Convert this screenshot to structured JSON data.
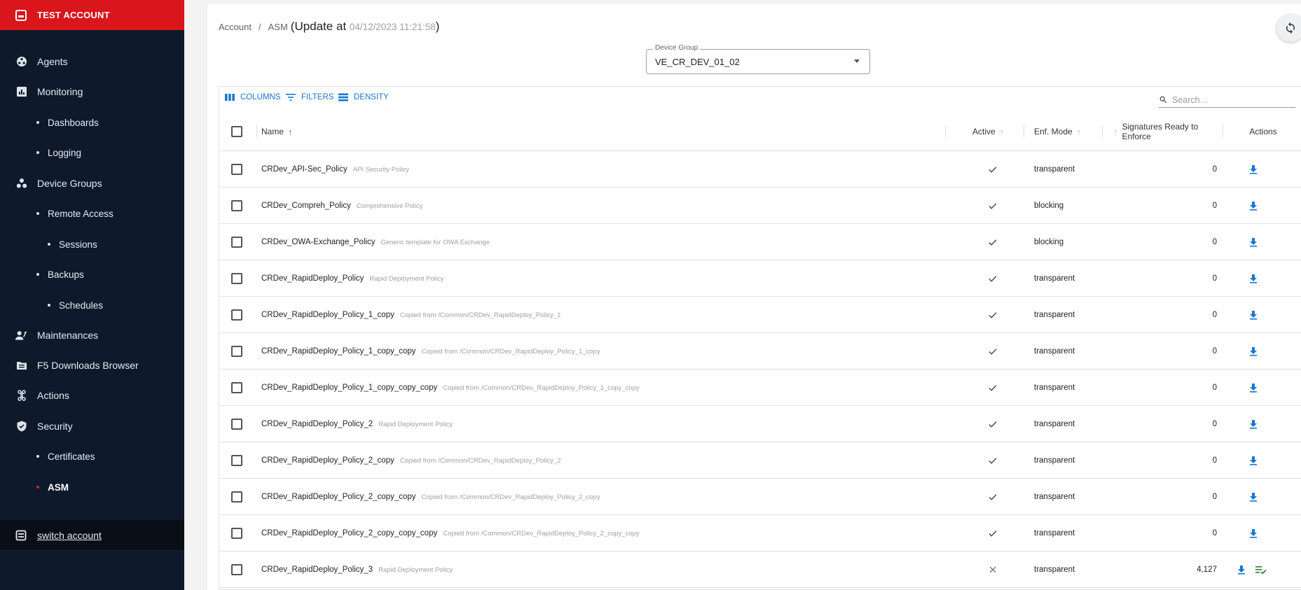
{
  "sidebar": {
    "account_title": "TEST ACCOUNT",
    "items": [
      {
        "label": "Agents",
        "level": "top",
        "icon": "agents-icon"
      },
      {
        "label": "Monitoring",
        "level": "top",
        "icon": "monitoring-icon"
      },
      {
        "label": "Dashboards",
        "level": "sub"
      },
      {
        "label": "Logging",
        "level": "sub"
      },
      {
        "label": "Device Groups",
        "level": "top",
        "icon": "device-groups-icon"
      },
      {
        "label": "Remote Access",
        "level": "sub"
      },
      {
        "label": "Sessions",
        "level": "sub2"
      },
      {
        "label": "Backups",
        "level": "sub"
      },
      {
        "label": "Schedules",
        "level": "sub2"
      },
      {
        "label": "Maintenances",
        "level": "top",
        "icon": "maintenances-icon"
      },
      {
        "label": "F5 Downloads Browser",
        "level": "top",
        "icon": "downloads-browser-icon"
      },
      {
        "label": "Actions",
        "level": "top",
        "icon": "actions-icon"
      },
      {
        "label": "Security",
        "level": "top",
        "icon": "shield-icon"
      },
      {
        "label": "Certificates",
        "level": "sub"
      },
      {
        "label": "ASM",
        "level": "sub",
        "active": true
      }
    ],
    "switch_account_label": "switch account"
  },
  "breadcrumb": {
    "account": "Account",
    "separator": "/",
    "asm": "ASM",
    "update_prefix": "(Update at ",
    "timestamp": "04/12/2023 11:21:58",
    "update_suffix": ")"
  },
  "device_group": {
    "label": "Device Group",
    "value": "VE_CR_DEV_01_02"
  },
  "toolbar": {
    "columns_label": "COLUMNS",
    "filters_label": "FILTERS",
    "density_label": "DENSITY",
    "search_placeholder": "Search…"
  },
  "table": {
    "headers": {
      "name": "Name",
      "active": "Active",
      "enf_mode": "Enf. Mode",
      "signatures": "Signatures Ready to Enforce",
      "actions": "Actions"
    },
    "rows": [
      {
        "name": "CRDev_API-Sec_Policy",
        "desc": "API Security Policy",
        "active": true,
        "mode": "transparent",
        "signatures": "0",
        "extra_action": false
      },
      {
        "name": "CRDev_Compreh_Policy",
        "desc": "Comprehensive Policy",
        "active": true,
        "mode": "blocking",
        "signatures": "0",
        "extra_action": false
      },
      {
        "name": "CRDev_OWA-Exchange_Policy",
        "desc": "Generic template for OWA Exchange",
        "active": true,
        "mode": "blocking",
        "signatures": "0",
        "extra_action": false
      },
      {
        "name": "CRDev_RapidDeploy_Policy",
        "desc": "Rapid Deployment Policy",
        "active": true,
        "mode": "transparent",
        "signatures": "0",
        "extra_action": false
      },
      {
        "name": "CRDev_RapidDeploy_Policy_1_copy",
        "desc": "Copied from /Common/CRDev_RapidDeploy_Policy_1",
        "active": true,
        "mode": "transparent",
        "signatures": "0",
        "extra_action": false
      },
      {
        "name": "CRDev_RapidDeploy_Policy_1_copy_copy",
        "desc": "Copied from /Common/CRDev_RapidDeploy_Policy_1_copy",
        "active": true,
        "mode": "transparent",
        "signatures": "0",
        "extra_action": false
      },
      {
        "name": "CRDev_RapidDeploy_Policy_1_copy_copy_copy",
        "desc": "Copied from /Common/CRDev_RapidDeploy_Policy_1_copy_copy",
        "active": true,
        "mode": "transparent",
        "signatures": "0",
        "extra_action": false
      },
      {
        "name": "CRDev_RapidDeploy_Policy_2",
        "desc": "Rapid Deployment Policy",
        "active": true,
        "mode": "transparent",
        "signatures": "0",
        "extra_action": false
      },
      {
        "name": "CRDev_RapidDeploy_Policy_2_copy",
        "desc": "Copied from /Common/CRDev_RapidDeploy_Policy_2",
        "active": true,
        "mode": "transparent",
        "signatures": "0",
        "extra_action": false
      },
      {
        "name": "CRDev_RapidDeploy_Policy_2_copy_copy",
        "desc": "Copied from /Common/CRDev_RapidDeploy_Policy_2_copy",
        "active": true,
        "mode": "transparent",
        "signatures": "0",
        "extra_action": false
      },
      {
        "name": "CRDev_RapidDeploy_Policy_2_copy_copy_copy",
        "desc": "Copied from /Common/CRDev_RapidDeploy_Policy_2_copy_copy",
        "active": true,
        "mode": "transparent",
        "signatures": "0",
        "extra_action": false
      },
      {
        "name": "CRDev_RapidDeploy_Policy_3",
        "desc": "Rapid Deployment Policy",
        "active": false,
        "mode": "transparent",
        "signatures": "4,127",
        "extra_action": true
      }
    ]
  },
  "colors": {
    "sidebar_bg": "#0e1a2b",
    "account_red": "#d9161c",
    "accent_blue": "#1976d2",
    "active_dot": "#e2232a"
  }
}
